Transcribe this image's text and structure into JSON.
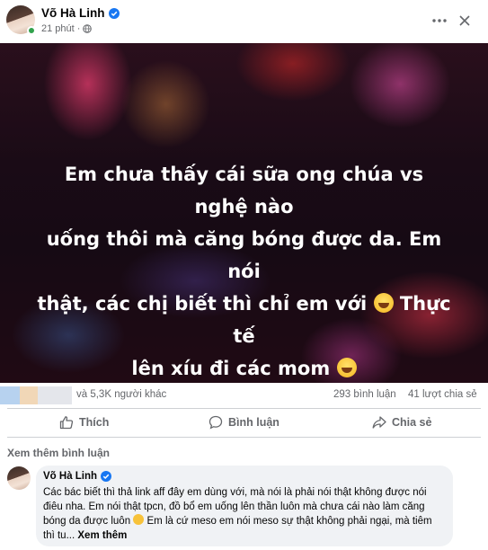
{
  "post": {
    "author": "Võ Hà Linh",
    "time": "21 phút",
    "text_lines": [
      "Em chưa thấy cái sữa ong chúa vs nghệ nào",
      "uống thôi mà căng bóng được da. Em nói",
      "thật, các chị biết thì chỉ em với",
      "Thực tế",
      "lên xíu đi các mom"
    ]
  },
  "stats": {
    "reactions_text": "và 5,3K người khác",
    "comments": "293 bình luận",
    "shares": "41 lượt chia sẻ"
  },
  "actions": {
    "like": "Thích",
    "comment": "Bình luận",
    "share": "Chia sẻ"
  },
  "comments_section": {
    "see_more": "Xem thêm bình luận",
    "comment": {
      "author": "Võ Hà Linh",
      "line1": "Các bác biết thì thả link aff đây em dùng với, mà nói là phải nói thật không được nói",
      "line2": "điêu nha. Em nói thật tpcn, đồ bổ em uống lên thần luôn mà chưa cái nào làm căng",
      "line3a": "bóng da được luôn",
      "line3b": "Em là cứ meso em nói meso sự thật không phải ngại, mà tiêm",
      "line4": "thì tu...",
      "see_more": "Xem thêm"
    }
  },
  "colors": {
    "verified": "#1877f2",
    "reaction_bar": [
      "#b7d2ef",
      "#f1d7b7",
      "#e4e6eb"
    ]
  },
  "icons": {
    "more": "more-icon",
    "close": "close-icon",
    "globe": "globe-icon",
    "like": "like-icon",
    "comment": "comment-icon",
    "share": "share-icon"
  }
}
